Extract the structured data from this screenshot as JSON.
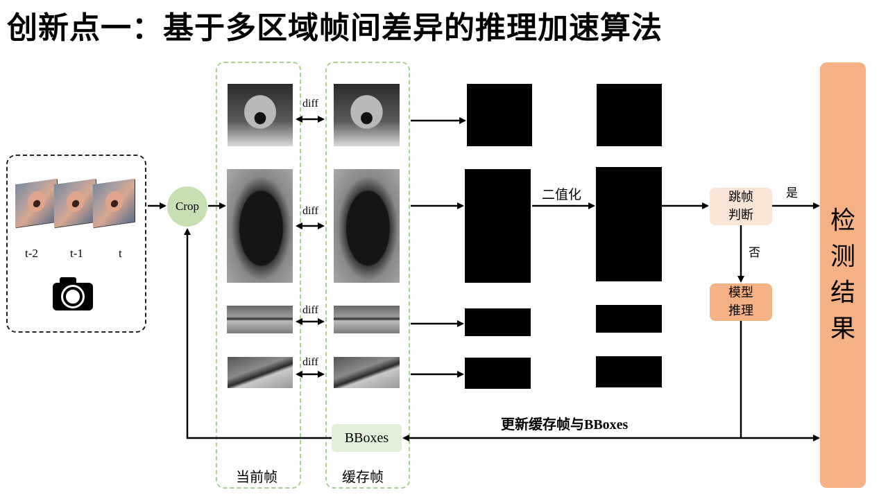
{
  "title": "创新点一：基于多区域帧间差异的推理加速算法",
  "input_frames": {
    "labels": [
      "t-2",
      "t-1",
      "t"
    ],
    "icon": "camera-icon"
  },
  "crop_label": "Crop",
  "diff_labels": [
    "diff",
    "diff",
    "diff",
    "diff"
  ],
  "current_frame_label": "当前帧",
  "cached_frame_label": "缓存帧",
  "binarize_label": "二值化",
  "skip_decision_label": "跳帧判断",
  "yes_label": "是",
  "no_label": "否",
  "model_inference_label": "模型推理",
  "result_label": "检测结果",
  "bboxes_label": "BBoxes",
  "update_label": "更新缓存帧与BBoxes",
  "colors": {
    "crop_node": "#c6e0b4",
    "frame_group_border": "#a9d18e",
    "skip_decision_fill": "#fbe5d6",
    "inference_fill": "#f4b183",
    "result_fill": "#f4b183",
    "bboxes_fill": "#e2f0d9"
  }
}
